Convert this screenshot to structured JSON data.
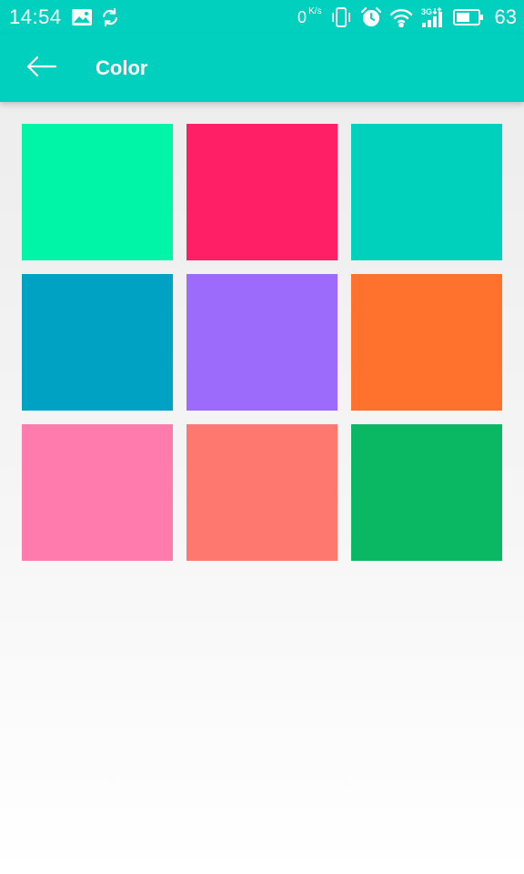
{
  "status_bar": {
    "time": "14:54",
    "net_speed_value": "0",
    "net_speed_unit": "K/s",
    "battery_level": "63",
    "icons": [
      "image-icon",
      "sync-icon",
      "vibrate-icon",
      "alarm-icon",
      "wifi-icon",
      "signal-3g-icon",
      "battery-icon"
    ]
  },
  "app_bar": {
    "back_icon": "arrow-left-icon",
    "title": "Color",
    "background_color": "#00d0bd"
  },
  "swatches": [
    {
      "name": "swatch-spring-green",
      "color": "#00f5a6"
    },
    {
      "name": "swatch-crimson-pink",
      "color": "#ff1f66"
    },
    {
      "name": "swatch-turquoise",
      "color": "#00d1bd"
    },
    {
      "name": "swatch-ocean-blue",
      "color": "#00a2c3"
    },
    {
      "name": "swatch-lavender",
      "color": "#9c6bfb"
    },
    {
      "name": "swatch-orange",
      "color": "#ff722e"
    },
    {
      "name": "swatch-pink",
      "color": "#ff7aad"
    },
    {
      "name": "swatch-salmon",
      "color": "#ff7870"
    },
    {
      "name": "swatch-green",
      "color": "#0ab864"
    }
  ]
}
